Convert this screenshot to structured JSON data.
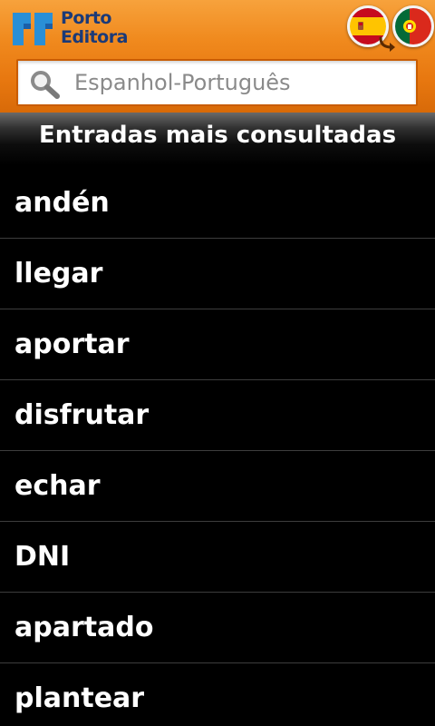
{
  "header": {
    "logo_line1": "Porto",
    "logo_line2": "Editora",
    "brand_color": "#1b3a78",
    "accent_color": "#f08a1e",
    "source_language_icon": "spain-flag-icon",
    "target_language_icon": "portugal-flag-icon",
    "swap_icon": "swap-arrow-icon"
  },
  "search": {
    "placeholder": "Espanhol-Português",
    "value": ""
  },
  "section": {
    "title": "Entradas mais consultadas"
  },
  "entries": [
    {
      "label": "andén"
    },
    {
      "label": "llegar"
    },
    {
      "label": "aportar"
    },
    {
      "label": "disfrutar"
    },
    {
      "label": "echar"
    },
    {
      "label": "DNI"
    },
    {
      "label": "apartado"
    },
    {
      "label": "plantear"
    }
  ]
}
